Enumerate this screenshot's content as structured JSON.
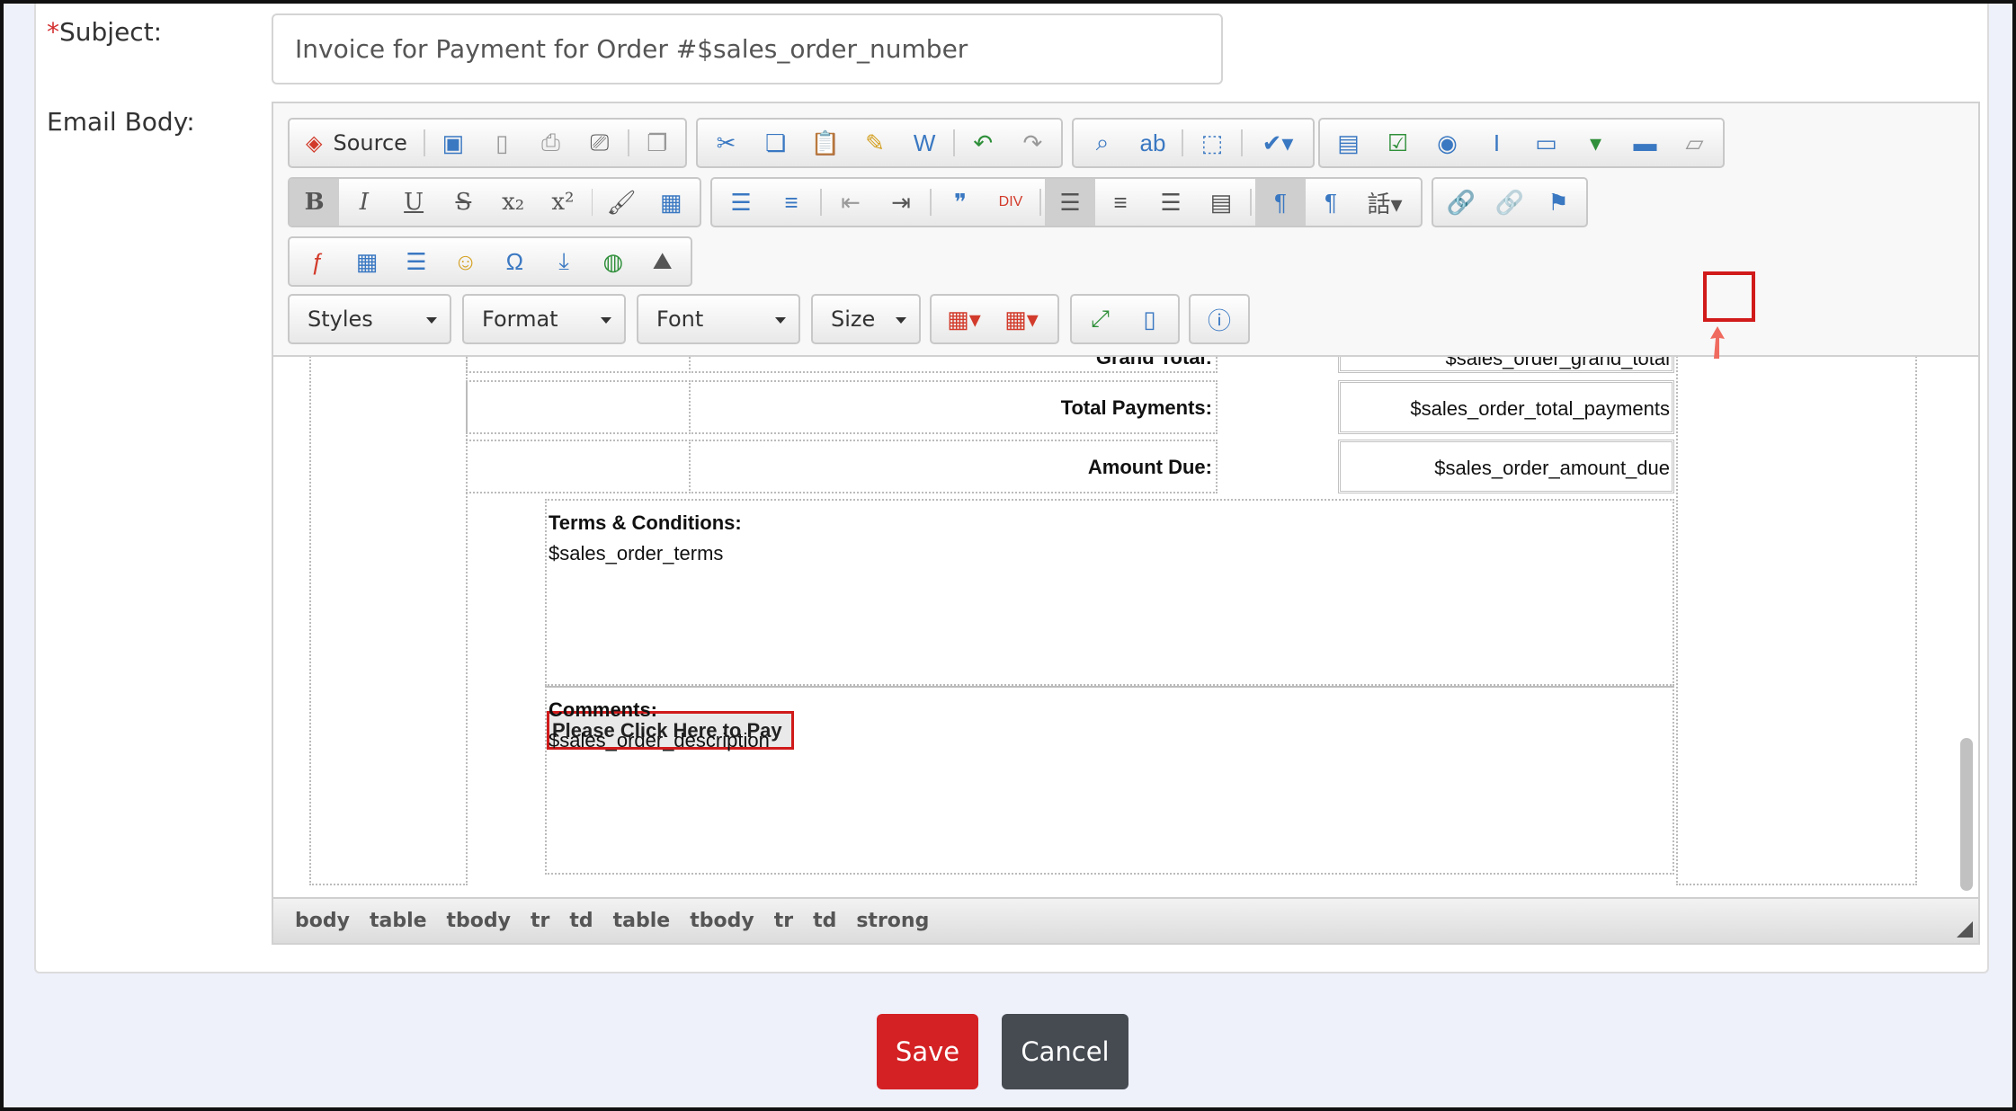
{
  "form": {
    "subject_required_mark": "*",
    "subject_label": "Subject:",
    "subject_value": "Invoice for Payment for Order #$sales_order_number",
    "body_label": "Email Body:"
  },
  "toolbar": {
    "source_label": "Source",
    "combos": {
      "styles": "Styles",
      "format": "Format",
      "font": "Font",
      "size": "Size"
    },
    "icons": {
      "row1": [
        "source-icon",
        "save-icon",
        "new-page-icon",
        "preview-icon",
        "print-icon",
        "templates-icon",
        "cut-icon",
        "copy-icon",
        "paste-icon",
        "paste-text-icon",
        "paste-word-icon",
        "undo-icon",
        "redo-icon",
        "find-icon",
        "replace-icon",
        "select-all-icon",
        "spellcheck-icon",
        "form-icon",
        "checkbox-icon",
        "radio-icon",
        "textfield-icon",
        "textarea-icon",
        "select-icon",
        "button-icon",
        "hidden-field-icon"
      ],
      "row2": [
        "bold-icon",
        "italic-icon",
        "underline-icon",
        "strike-icon",
        "subscript-icon",
        "superscript-icon",
        "copy-format-icon",
        "remove-format-icon",
        "numbered-list-icon",
        "bulleted-list-icon",
        "outdent-icon",
        "indent-icon",
        "blockquote-icon",
        "div-icon",
        "align-left-icon",
        "align-center-icon",
        "align-right-icon",
        "justify-icon",
        "ltr-icon",
        "rtl-icon",
        "language-icon",
        "link-icon",
        "unlink-icon",
        "anchor-icon"
      ],
      "row3": [
        "flash-icon",
        "table-icon",
        "horizontal-rule-icon",
        "smiley-icon",
        "special-char-icon",
        "page-break-icon",
        "iframe-icon",
        "image-icon"
      ]
    },
    "colors": {
      "accent_red": "#d11a1a",
      "icon_blue": "#3a78c2",
      "icon_green": "#2f8f3a"
    }
  },
  "content": {
    "grand_total_label": "Grand Total:",
    "grand_total_value": "$sales_order_grand_total",
    "total_payments_label": "Total Payments:",
    "total_payments_value": "$sales_order_total_payments",
    "amount_due_label": "Amount Due:",
    "amount_due_value": "$sales_order_amount_due",
    "terms_label": "Terms & Conditions:",
    "terms_value": "$sales_order_terms",
    "pay_link": "Please Click Here to Pay",
    "comments_label": "Comments:",
    "comments_value": "$sales_order_description"
  },
  "statusbar": {
    "path": [
      "body",
      "table",
      "tbody",
      "tr",
      "td",
      "table",
      "tbody",
      "tr",
      "td",
      "strong"
    ]
  },
  "actions": {
    "save": "Save",
    "cancel": "Cancel"
  }
}
